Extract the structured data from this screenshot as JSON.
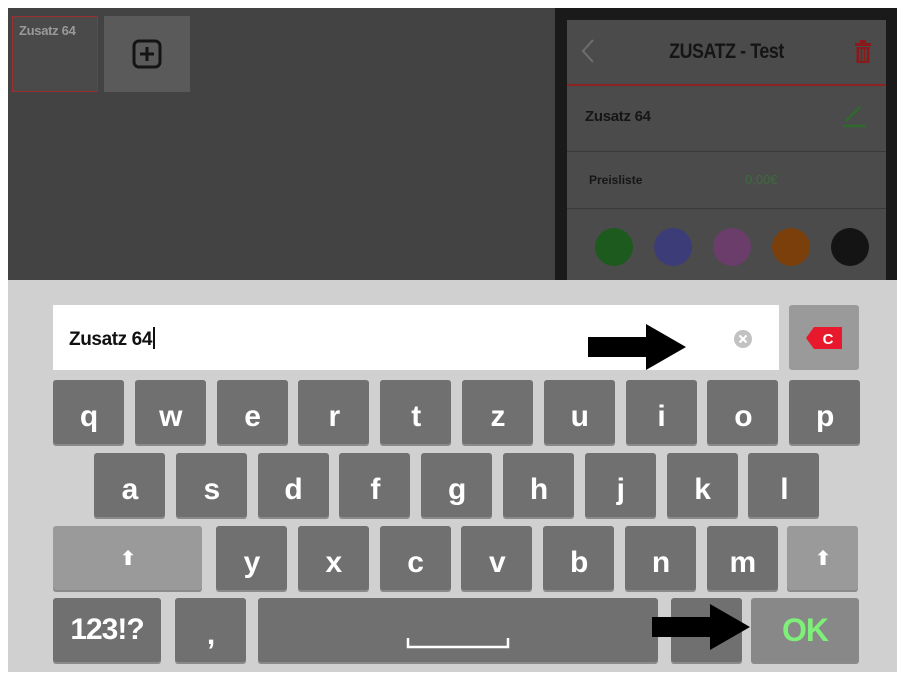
{
  "app": {
    "tiles": {
      "zusatz_label": "Zusatz 64"
    },
    "panel": {
      "title": "ZUSATZ - Test",
      "item_name": "Zusatz 64",
      "price_label": "Preisliste",
      "price_value": "0,00€",
      "colors": [
        "#1d5a1d",
        "#3c3c78",
        "#6a3d6a",
        "#7a3f0a",
        "#141414"
      ]
    }
  },
  "keyboard": {
    "text_value": "Zusatz 64",
    "backspace_label": "C",
    "rows": [
      [
        "q",
        "w",
        "e",
        "r",
        "t",
        "z",
        "u",
        "i",
        "o",
        "p"
      ],
      [
        "a",
        "s",
        "d",
        "f",
        "g",
        "h",
        "j",
        "k",
        "l"
      ],
      [
        "y",
        "x",
        "c",
        "v",
        "b",
        "n",
        "m"
      ]
    ],
    "shift_label": "⬆",
    "numbers_label": "123!?",
    "comma_label": ",",
    "ok_label": "OK",
    "accent_color": "#e8192c"
  }
}
